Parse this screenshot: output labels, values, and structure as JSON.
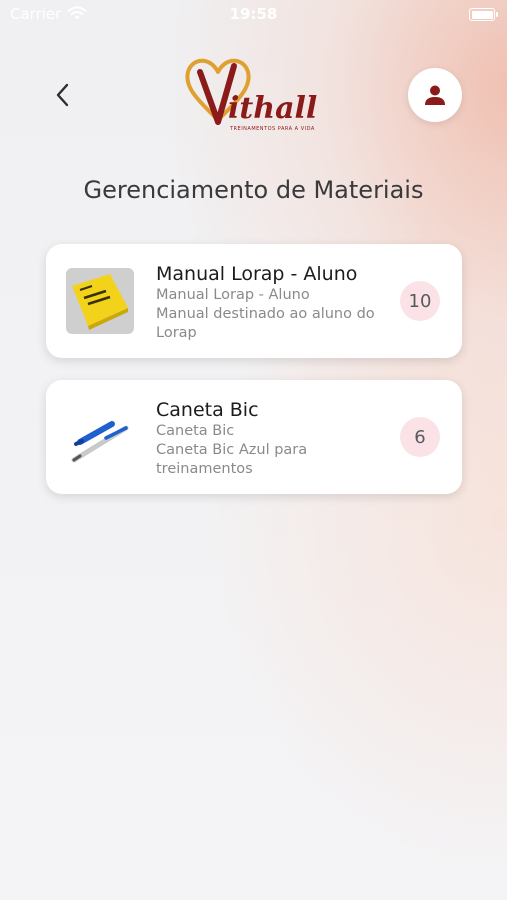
{
  "status_bar": {
    "carrier": "Carrier",
    "time": "19:58"
  },
  "header": {
    "brand_logo_text": "Vithall",
    "brand_tagline": "TREINAMENTOS PARA A VIDA",
    "back_icon": "chevron-left-icon",
    "profile_icon": "user-icon"
  },
  "page": {
    "title": "Gerenciamento de Materiais"
  },
  "materials": [
    {
      "name": "Manual Lorap - Aluno",
      "subtitle": "Manual Lorap - Aluno",
      "description": "Manual destinado ao aluno do Lorap",
      "quantity": "10",
      "thumbnail": "yellow-book-icon"
    },
    {
      "name": "Caneta Bic",
      "subtitle": "Caneta Bic",
      "description": "Caneta Bic Azul para treinamentos",
      "quantity": "6",
      "thumbnail": "blue-pen-icon"
    }
  ],
  "colors": {
    "accent": "#8b1a1a",
    "badge_background": "#fbe2e6",
    "logo_gold": "#e0a030"
  }
}
